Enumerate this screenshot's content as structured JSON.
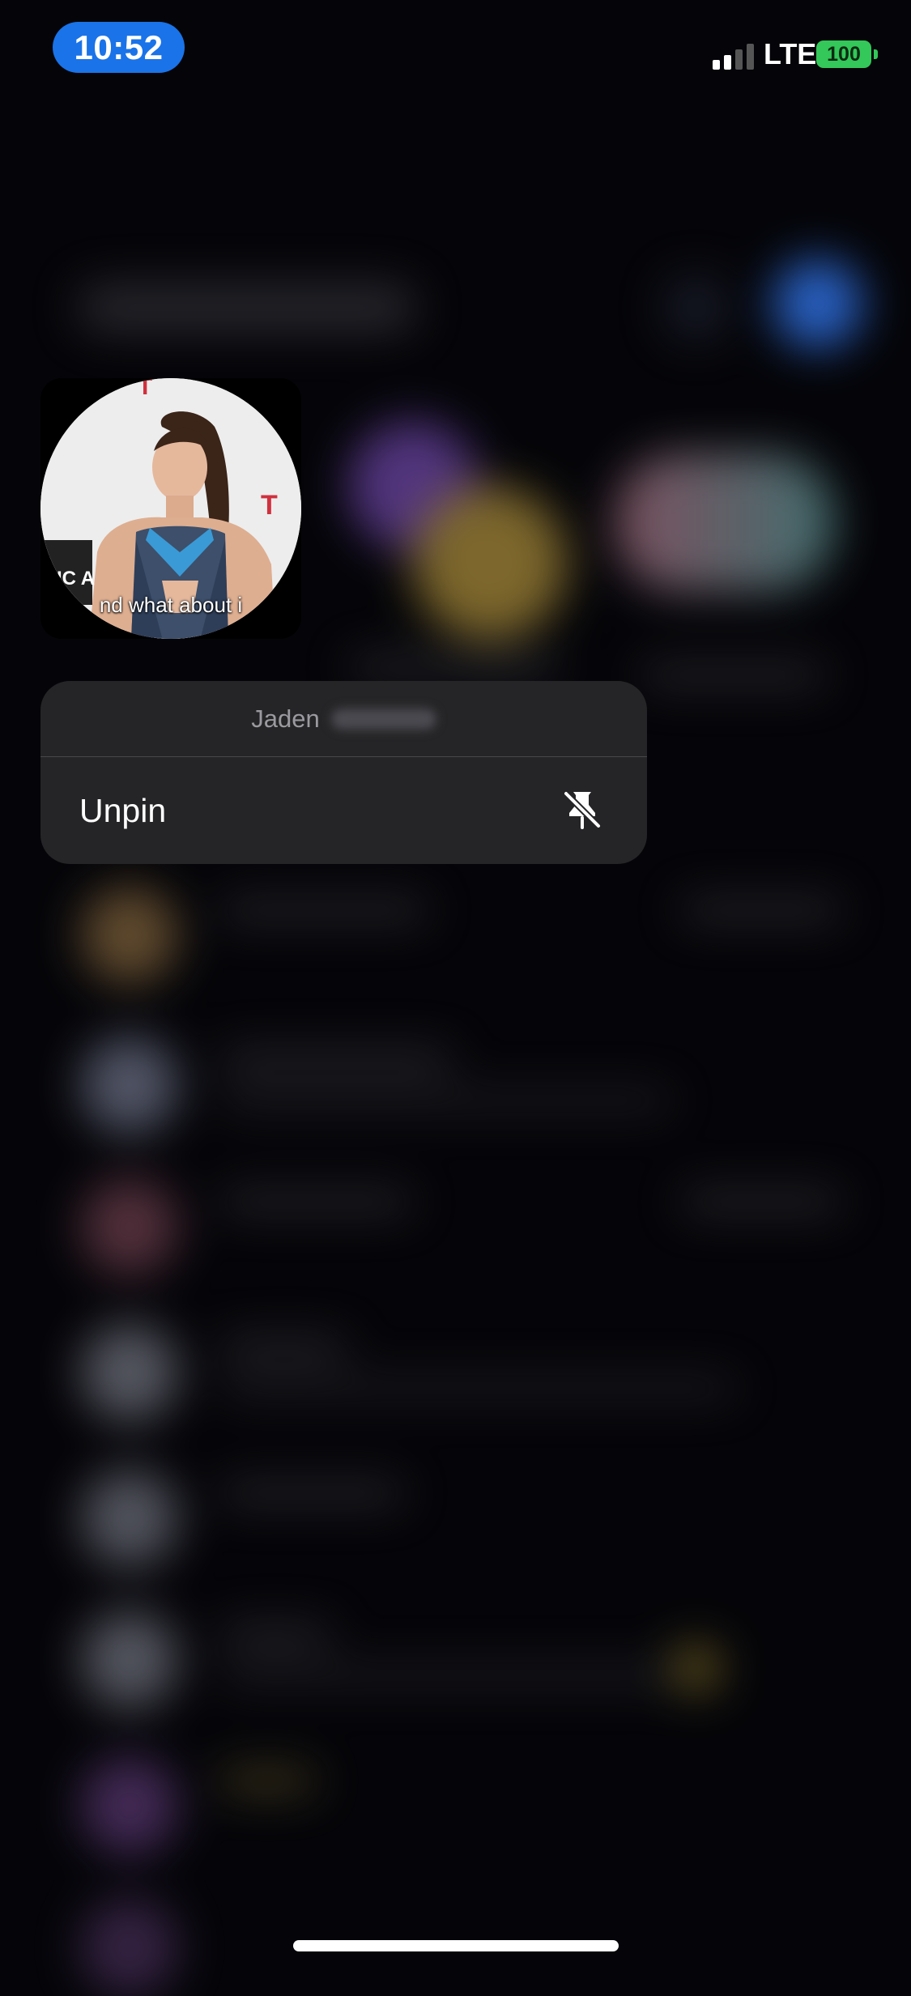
{
  "status_bar": {
    "time": "10:52",
    "network": "LTE",
    "battery": "100",
    "signal_bars": 2,
    "time_pill_color": "#1a73e8",
    "battery_color": "#34c759"
  },
  "avatar_preview": {
    "caption": "nd what about i"
  },
  "context_menu": {
    "contact_name": "Jaden",
    "items": [
      {
        "label": "Unpin",
        "icon": "unpin-icon"
      }
    ]
  }
}
